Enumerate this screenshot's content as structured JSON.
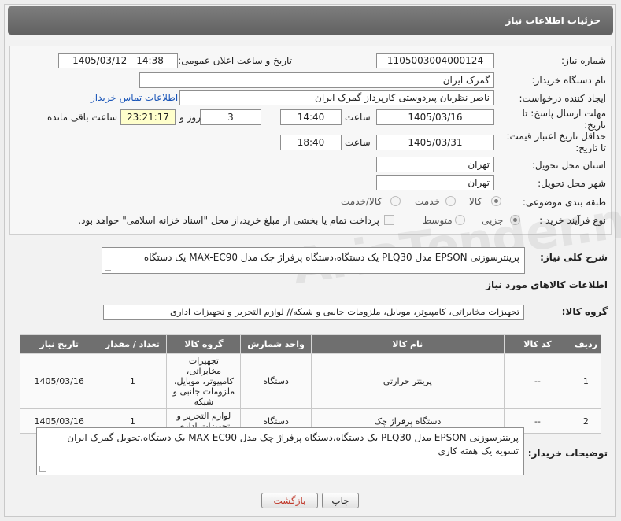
{
  "header": {
    "title": "جزئیات اطلاعات نیاز"
  },
  "form": {
    "need_number_label": "شماره نیاز:",
    "need_number": "1105003004000124",
    "announce_label": "تاریخ و ساعت اعلان عمومی:",
    "announce_value": "1405/03/12 - 14:38",
    "buyer_org_label": "نام دستگاه خریدار:",
    "buyer_org": "گمرک ایران",
    "creator_label": "ایجاد کننده درخواست:",
    "creator": "ناصر نظریان پیردوستی کارپرداز گمرک ایران",
    "contact_link": "اطلاعات تماس خریدار",
    "deadline_label": "مهلت ارسال پاسخ: تا تاریخ:",
    "deadline_date": "1405/03/16",
    "time_label": "ساعت",
    "deadline_time": "14:40",
    "days_value": "3",
    "days_label": "روز و",
    "remaining_value": "23:21:17",
    "remaining_label": "ساعت باقی مانده",
    "validity_label": "حداقل تاریخ اعتبار قیمت: تا تاریخ:",
    "validity_date": "1405/03/31",
    "validity_time": "18:40",
    "province_label": "استان محل تحویل:",
    "province": "تهران",
    "city_label": "شهر محل تحویل:",
    "city": "تهران",
    "category_label": "طبقه بندی موضوعی:",
    "category_options": [
      "کالا",
      "خدمت",
      "کالا/خدمت"
    ],
    "category_selected": "کالا",
    "process_label": "نوع فرآیند خرید :",
    "process_options": [
      "جزیی",
      "متوسط"
    ],
    "process_selected": "جزیی",
    "payment_note": "پرداخت تمام یا بخشی از مبلغ خرید،از محل \"اسناد خزانه اسلامی\" خواهد بود."
  },
  "summary": {
    "label": "شرح کلی نیاز:",
    "text": "پرینترسوزنی EPSON مدل PLQ30  یک دستگاه،دستگاه پرفراژ چک مدل MAX-EC90  یک دستگاه"
  },
  "goods": {
    "section_title": "اطلاعات کالاهای مورد نیاز",
    "group_label": "گروه کالا:",
    "group_value": "تجهیزات مخابراتی، کامپیوتر، موبایل، ملزومات جانبی و شبکه// لوازم التحریر و تجهیزات اداری",
    "columns": [
      "ردیف",
      "کد کالا",
      "نام کالا",
      "واحد شمارش",
      "گروه کالا",
      "تعداد / مقدار",
      "تاریخ نیاز"
    ],
    "rows": [
      {
        "row": "1",
        "code": "--",
        "name": "پرینتر حرارتی",
        "unit": "دستگاه",
        "group": "تجهیزات مخابراتی، کامپیوتر، موبایل، ملزومات جانبی و شبکه",
        "qty": "1",
        "date": "1405/03/16"
      },
      {
        "row": "2",
        "code": "--",
        "name": "دستگاه پرفراژ چک",
        "unit": "دستگاه",
        "group": "لوازم التحریر و تجهیزات اداری",
        "qty": "1",
        "date": "1405/03/16"
      }
    ]
  },
  "buyer_notes": {
    "label": "توضیحات خریدار:",
    "text": "پرینترسوزنی EPSON مدل PLQ30  یک دستگاه،دستگاه پرفراژ چک مدل MAX-EC90  یک دستگاه،تحویل گمرک ایران تسویه یک هفته کاری"
  },
  "buttons": {
    "print": "چاپ",
    "back": "بازگشت"
  },
  "watermark": "AriaTender.net",
  "colors": {
    "header": "#6f6f6f",
    "link": "#1a55b8",
    "remaining_bg": "#ffffcc",
    "back_text": "#c0392b"
  }
}
